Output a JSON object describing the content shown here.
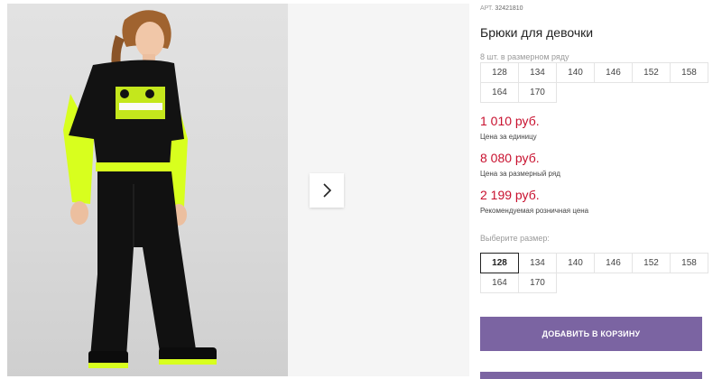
{
  "product": {
    "art_label": "АРТ.",
    "art_number": "32421810",
    "title": "Брюки для девочки"
  },
  "pack": {
    "label": "8 шт. в размерном ряду",
    "sizes": [
      "128",
      "134",
      "140",
      "146",
      "152",
      "158",
      "164",
      "170"
    ]
  },
  "prices": [
    {
      "value": "1 010 руб.",
      "note": "Цена за единицу"
    },
    {
      "value": "8 080 руб.",
      "note": "Цена за размерный ряд"
    },
    {
      "value": "2 199 руб.",
      "note": "Рекомендуемая розничная цена"
    }
  ],
  "size_select": {
    "label": "Выберите размер:",
    "sizes": [
      "128",
      "134",
      "140",
      "146",
      "152",
      "158",
      "164",
      "170"
    ],
    "selected": "128"
  },
  "cart": {
    "button_label": "ДОБАВИТЬ В КОРЗИНУ"
  },
  "gallery": {
    "next_icon": "chevron-right-icon"
  },
  "colors": {
    "accent": "#7b64a2",
    "price": "#c8102e",
    "neon": "#d8ff1e"
  }
}
